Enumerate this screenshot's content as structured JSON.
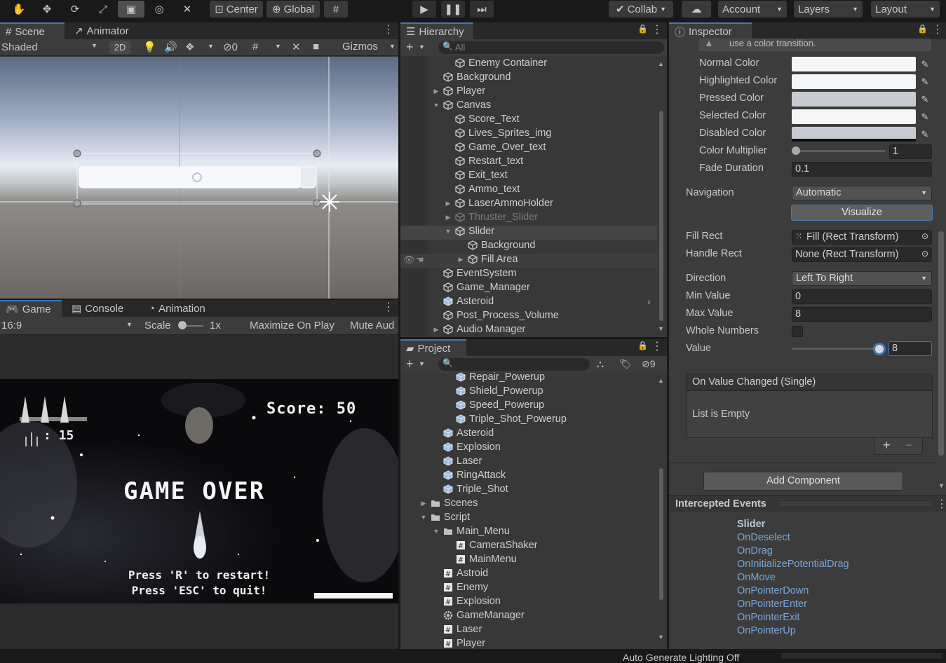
{
  "toolbar": {
    "pivot": "Center",
    "space": "Global",
    "collab": "Collab",
    "account": "Account",
    "layers": "Layers",
    "layout": "Layout"
  },
  "scene": {
    "tab_scene": "Scene",
    "tab_animator": "Animator",
    "shading": "Shaded",
    "mode_2d": "2D",
    "hidden_count": "0",
    "gizmos": "Gizmos"
  },
  "game": {
    "tab_game": "Game",
    "tab_console": "Console",
    "tab_animation": "Animation",
    "aspect": "16:9",
    "scale_label": "Scale",
    "scale_value": "1x",
    "maximize": "Maximize On Play",
    "mute": "Mute Aud",
    "score": "Score: 50",
    "ammo": ": 15",
    "game_over": "GAME OVER",
    "restart_hint": "Press 'R' to restart!",
    "quit_hint": "Press 'ESC' to quit!"
  },
  "hierarchy": {
    "tab": "Hierarchy",
    "search_placeholder": "All",
    "items": [
      {
        "label": "Enemy Container",
        "indent": 1,
        "arrow": ""
      },
      {
        "label": "Background",
        "indent": 0,
        "arrow": ""
      },
      {
        "label": "Player",
        "indent": 0,
        "arrow": "▶"
      },
      {
        "label": "Canvas",
        "indent": 0,
        "arrow": "▼"
      },
      {
        "label": "Score_Text",
        "indent": 1,
        "arrow": ""
      },
      {
        "label": "Lives_Sprites_img",
        "indent": 1,
        "arrow": ""
      },
      {
        "label": "Game_Over_text",
        "indent": 1,
        "arrow": ""
      },
      {
        "label": "Restart_text",
        "indent": 1,
        "arrow": ""
      },
      {
        "label": "Exit_text",
        "indent": 1,
        "arrow": ""
      },
      {
        "label": "Ammo_text",
        "indent": 1,
        "arrow": ""
      },
      {
        "label": "LaserAmmoHolder",
        "indent": 1,
        "arrow": "▶"
      },
      {
        "label": "Thruster_Slider",
        "indent": 1,
        "arrow": "▶"
      },
      {
        "label": "Slider",
        "indent": 1,
        "arrow": "▼"
      },
      {
        "label": "Background",
        "indent": 2,
        "arrow": ""
      },
      {
        "label": "Fill Area",
        "indent": 2,
        "arrow": "▶"
      },
      {
        "label": "EventSystem",
        "indent": 0,
        "arrow": ""
      },
      {
        "label": "Game_Manager",
        "indent": 0,
        "arrow": ""
      },
      {
        "label": "Asteroid",
        "indent": 0,
        "arrow": ""
      },
      {
        "label": "Post_Process_Volume",
        "indent": 0,
        "arrow": ""
      },
      {
        "label": "Audio Manager",
        "indent": 0,
        "arrow": "▶"
      }
    ]
  },
  "project": {
    "tab": "Project",
    "hidden_count": "9",
    "items": [
      {
        "label": "Repair_Powerup",
        "indent": 2,
        "icon": "prefab"
      },
      {
        "label": "Shield_Powerup",
        "indent": 2,
        "icon": "prefab"
      },
      {
        "label": "Speed_Powerup",
        "indent": 2,
        "icon": "prefab"
      },
      {
        "label": "Triple_Shot_Powerup",
        "indent": 2,
        "icon": "prefab"
      },
      {
        "label": "Asteroid",
        "indent": 1,
        "icon": "prefab"
      },
      {
        "label": "Explosion",
        "indent": 1,
        "icon": "prefab"
      },
      {
        "label": "Laser",
        "indent": 1,
        "icon": "prefab"
      },
      {
        "label": "RingAttack",
        "indent": 1,
        "icon": "prefab"
      },
      {
        "label": "Triple_Shot",
        "indent": 1,
        "icon": "prefab"
      },
      {
        "label": "Scenes",
        "indent": 0,
        "icon": "folder",
        "arrow": "▶"
      },
      {
        "label": "Script",
        "indent": 0,
        "icon": "folder",
        "arrow": "▼"
      },
      {
        "label": "Main_Menu",
        "indent": 1,
        "icon": "folder",
        "arrow": "▼"
      },
      {
        "label": "CameraShaker",
        "indent": 2,
        "icon": "script"
      },
      {
        "label": "MainMenu",
        "indent": 2,
        "icon": "script"
      },
      {
        "label": "Astroid",
        "indent": 1,
        "icon": "script"
      },
      {
        "label": "Enemy",
        "indent": 1,
        "icon": "script"
      },
      {
        "label": "Explosion",
        "indent": 1,
        "icon": "script"
      },
      {
        "label": "GameManager",
        "indent": 1,
        "icon": "gear"
      },
      {
        "label": "Laser",
        "indent": 1,
        "icon": "script"
      },
      {
        "label": "Player",
        "indent": 1,
        "icon": "script"
      }
    ]
  },
  "inspector": {
    "tab": "Inspector",
    "hint": "use a color transition.",
    "normal_color": "Normal Color",
    "highlighted_color": "Highlighted Color",
    "pressed_color": "Pressed Color",
    "selected_color": "Selected Color",
    "disabled_color": "Disabled Color",
    "color_multiplier": "Color Multiplier",
    "color_multiplier_value": "1",
    "fade_duration": "Fade Duration",
    "fade_duration_value": "0.1",
    "navigation": "Navigation",
    "navigation_value": "Automatic",
    "visualize": "Visualize",
    "fill_rect": "Fill Rect",
    "fill_rect_value": "Fill (Rect Transform)",
    "handle_rect": "Handle Rect",
    "handle_rect_value": "None (Rect Transform)",
    "direction": "Direction",
    "direction_value": "Left To Right",
    "min_value": "Min Value",
    "min_value_value": "0",
    "max_value": "Max Value",
    "max_value_value": "8",
    "whole_numbers": "Whole Numbers",
    "value": "Value",
    "value_value": "8",
    "value_fraction": 1.0,
    "color_multiplier_fraction": 0.0,
    "on_value_changed": "On Value Changed (Single)",
    "list_empty": "List is Empty",
    "add_component": "Add Component",
    "intercepted_events": "Intercepted Events",
    "events_header": "Slider",
    "events": [
      "OnDeselect",
      "OnDrag",
      "OnInitializePotentialDrag",
      "OnMove",
      "OnPointerDown",
      "OnPointerEnter",
      "OnPointerExit",
      "OnPointerUp"
    ]
  },
  "status_bar": {
    "lighting": "Auto Generate Lighting Off"
  },
  "colors": {
    "accent": "#3a79bb",
    "event_link": "#7aa6d8",
    "normal_swatch": "#f4f6f8",
    "pressed_swatch": "#c8ccd2",
    "disabled_swatch": "#c8ccd2"
  }
}
